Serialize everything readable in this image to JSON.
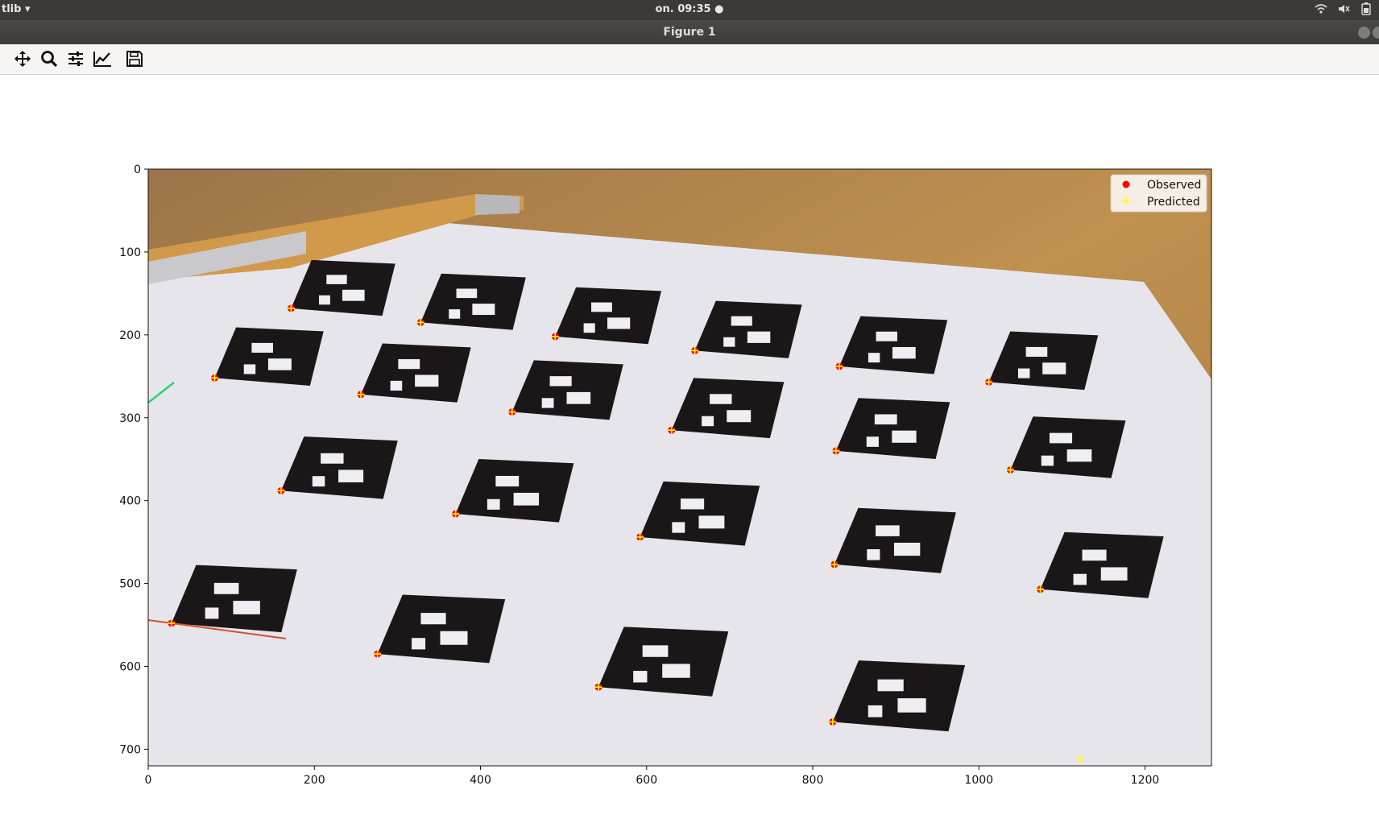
{
  "topbar": {
    "app_menu": "tlib",
    "clock": "on. 09:35"
  },
  "window": {
    "title": "Figure 1"
  },
  "toolbar": {
    "icons": [
      "move-icon",
      "zoom-icon",
      "configure-subplots-icon",
      "edit-axis-icon",
      "save-icon"
    ]
  },
  "chart_data": {
    "type": "scatter",
    "title": "",
    "xlabel": "",
    "ylabel": "",
    "xlim": [
      0,
      1280
    ],
    "ylim": [
      720,
      0
    ],
    "x_ticks": [
      "0",
      "200",
      "400",
      "600",
      "800",
      "1000",
      "1200"
    ],
    "y_ticks": [
      "0",
      "100",
      "200",
      "300",
      "400",
      "500",
      "600",
      "700"
    ],
    "legend": {
      "placement": "top-right",
      "entries": [
        "Observed",
        "Predicted"
      ]
    },
    "series": [
      {
        "name": "Observed",
        "color": "#ff0000",
        "marker": "circle",
        "points": [
          [
            172,
            168
          ],
          [
            328,
            185
          ],
          [
            490,
            202
          ],
          [
            658,
            219
          ],
          [
            832,
            238
          ],
          [
            1012,
            257
          ],
          [
            80,
            252
          ],
          [
            256,
            272
          ],
          [
            438,
            293
          ],
          [
            630,
            315
          ],
          [
            828,
            340
          ],
          [
            1038,
            363
          ],
          [
            160,
            388
          ],
          [
            370,
            416
          ],
          [
            592,
            444
          ],
          [
            826,
            477
          ],
          [
            1074,
            507
          ],
          [
            28,
            548
          ],
          [
            276,
            585
          ],
          [
            542,
            625
          ],
          [
            824,
            667
          ]
        ]
      },
      {
        "name": "Predicted",
        "color": "#ffff00",
        "marker": "plus",
        "points": [
          [
            172,
            168
          ],
          [
            328,
            185
          ],
          [
            490,
            202
          ],
          [
            658,
            219
          ],
          [
            832,
            238
          ],
          [
            1012,
            257
          ],
          [
            80,
            252
          ],
          [
            256,
            272
          ],
          [
            438,
            293
          ],
          [
            630,
            315
          ],
          [
            828,
            340
          ],
          [
            1038,
            363
          ],
          [
            160,
            388
          ],
          [
            370,
            416
          ],
          [
            592,
            444
          ],
          [
            826,
            477
          ],
          [
            1074,
            507
          ],
          [
            28,
            548
          ],
          [
            276,
            585
          ],
          [
            542,
            625
          ],
          [
            824,
            667
          ],
          [
            1122,
            712
          ]
        ]
      }
    ]
  }
}
